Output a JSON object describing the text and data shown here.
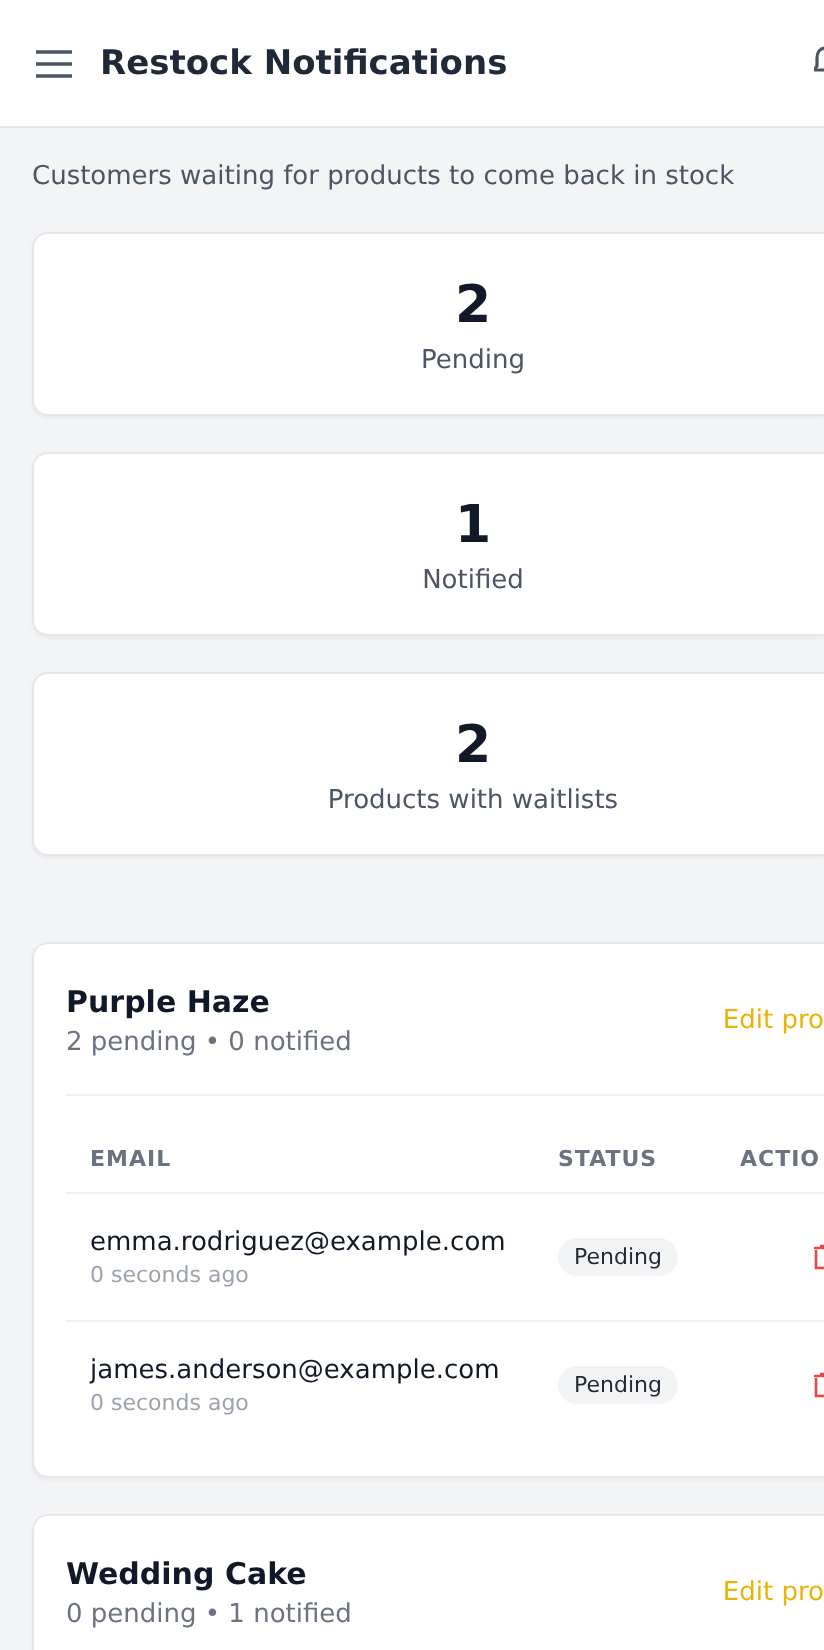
{
  "header": {
    "title": "Restock Notifications"
  },
  "subtitle": "Customers waiting for products to come back in stock",
  "stats": [
    {
      "value": "2",
      "label": "Pending"
    },
    {
      "value": "1",
      "label": "Notified"
    },
    {
      "value": "2",
      "label": "Products with waitlists"
    }
  ],
  "products": [
    {
      "name": "Purple Haze",
      "summary": "2 pending • 0 notified",
      "action": "Edit pro",
      "table": {
        "columns": [
          "EMAIL",
          "STATUS",
          "ACTIO"
        ],
        "rows": [
          {
            "email": "emma.rodriguez@example.com",
            "time": "0 seconds ago",
            "status": "Pending"
          },
          {
            "email": "james.anderson@example.com",
            "time": "0 seconds ago",
            "status": "Pending"
          }
        ]
      }
    },
    {
      "name": "Wedding Cake",
      "summary": "0 pending • 1 notified",
      "action": "Edit pro"
    }
  ]
}
